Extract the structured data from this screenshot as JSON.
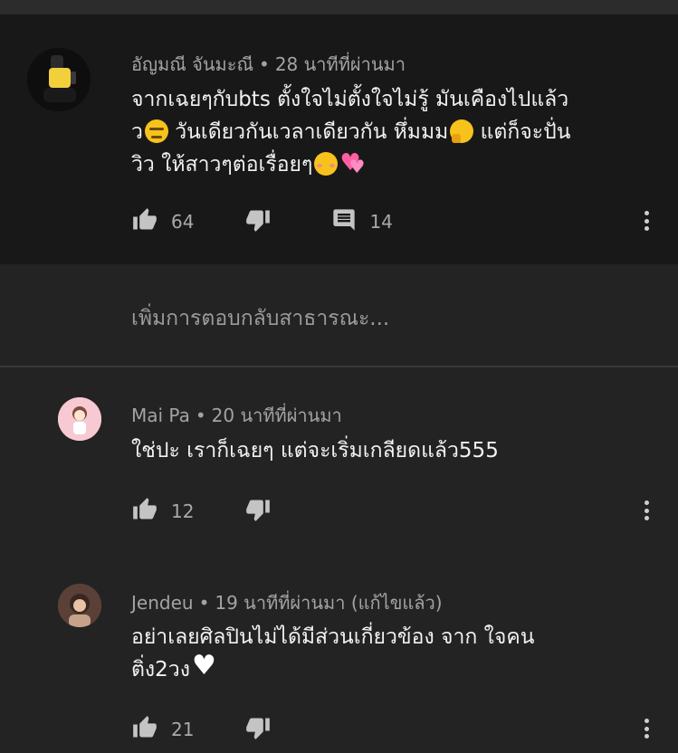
{
  "colors": {
    "background": "#232323",
    "pinned_background": "#181818",
    "meta_text": "#a3a3a3",
    "action_text": "#a9a9a9"
  },
  "comments": [
    {
      "author": "อัญมณี จันมะณี",
      "time": "28 นาทีที่ผ่านมา",
      "edited": "",
      "lines": [
        "จากเฉยๆกับbts ตั้งใจไม่ตั้งใจไม่รู้  มันเคืองไปแล้ว",
        "ว",
        "  วันเดียวกันเวลาเดียวกัน หึ่มมม",
        " แต่ก็จะปั่น",
        "วิว ให้สาวๆต่อเรื่อยๆ"
      ],
      "likes": "64",
      "replies": "14",
      "icons": [
        "thumb-up-icon",
        "thumb-down-icon",
        "comment-icon",
        "more-vert-icon"
      ]
    },
    {
      "author": "Mai Pa",
      "time": "20 นาทีที่ผ่านมา",
      "edited": "",
      "lines": [
        "ใช่ปะ เราก็เฉยๆ แต่จะเริ่มเกลียดแล้ว555"
      ],
      "likes": "12",
      "icons": [
        "thumb-up-icon",
        "thumb-down-icon",
        "more-vert-icon"
      ]
    },
    {
      "author": "Jendeu",
      "time": "19 นาทีที่ผ่านมา",
      "edited": "(แก้ไขแล้ว)",
      "lines": [
        "อย่าเลยศิลปินไม่ได้มีส่วนเกี่ยวข้อง จาก ใจคน",
        "ติ่ง2วง"
      ],
      "likes": "21",
      "icons": [
        "thumb-up-icon",
        "thumb-down-icon",
        "more-vert-icon"
      ]
    }
  ],
  "reply_placeholder": "เพิ่มการตอบกลับสาธารณะ..."
}
